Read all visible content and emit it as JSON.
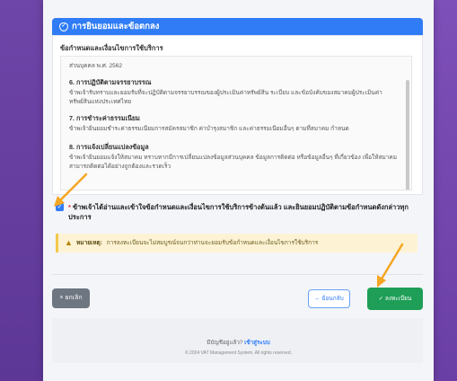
{
  "header": {
    "title": "การยินยอมและข้อตกลง",
    "icon": "shield-icon"
  },
  "panel": {
    "subheading": "ข้อกำหนดและเงื่อนไขการใช้บริการ",
    "sections": [
      {
        "heading": "",
        "text": "ส่วนบุคคล พ.ศ. 2562"
      },
      {
        "heading": "6. การปฏิบัติตามจรรยาบรรณ",
        "text": "ข้าพเจ้ารับทราบและยอมรับที่จะปฏิบัติตามจรรยาบรรณของผู้ประเมินค่าทรัพย์สิน ระเบียบ และข้อบังคับของสมาคมผู้ประเมินค่าทรัพย์สินแห่งประเทศไทย"
      },
      {
        "heading": "7. การชำระค่าธรรมเนียม",
        "text": "ข้าพเจ้ายินยอมชำระค่าธรรมเนียมการสมัครสมาชิก ค่าบำรุงสมาชิก และค่าธรรมเนียมอื่นๆ ตามที่สมาคม กำหนด"
      },
      {
        "heading": "8. การแจ้งเปลี่ยนแปลงข้อมูล",
        "text": "ข้าพเจ้ายินยอมแจ้งให้สมาคม ทราบหากมีการเปลี่ยนแปลงข้อมูลส่วนบุคคล ข้อมูลการติดต่อ หรือข้อมูลอื่นๆ ที่เกี่ยวข้อง เพื่อให้สมาคม สามารถติดต่อได้อย่างถูกต้องและรวดเร็ว"
      }
    ]
  },
  "consent": {
    "checked": true,
    "required_mark": "*",
    "label": "ข้าพเจ้าได้อ่านและเข้าใจข้อกำหนดและเงื่อนไขการใช้บริการข้างต้นแล้ว และยินยอมปฏิบัติตามข้อกำหนดดังกล่าวทุกประการ"
  },
  "warning": {
    "label": "หมายเหตุ:",
    "text": "การลงทะเบียนจะไม่สมบูรณ์จนกว่าท่านจะยอมรับข้อกำหนดและเงื่อนไขการใช้บริการ"
  },
  "buttons": {
    "cancel": "× ยกเลิก",
    "back": "← ย้อนกลับ",
    "register": "✓ ลงทะเบียน"
  },
  "footer": {
    "question": "มีบัญชีอยู่แล้ว?",
    "login_link": "เข้าสู่ระบบ",
    "copyright": "© 2024 VAT Management System. All rights reserved."
  },
  "colors": {
    "accent": "#2f7cf6",
    "success": "#1e9e57",
    "arrow": "#f5a623",
    "background": "#6b3fa0"
  }
}
